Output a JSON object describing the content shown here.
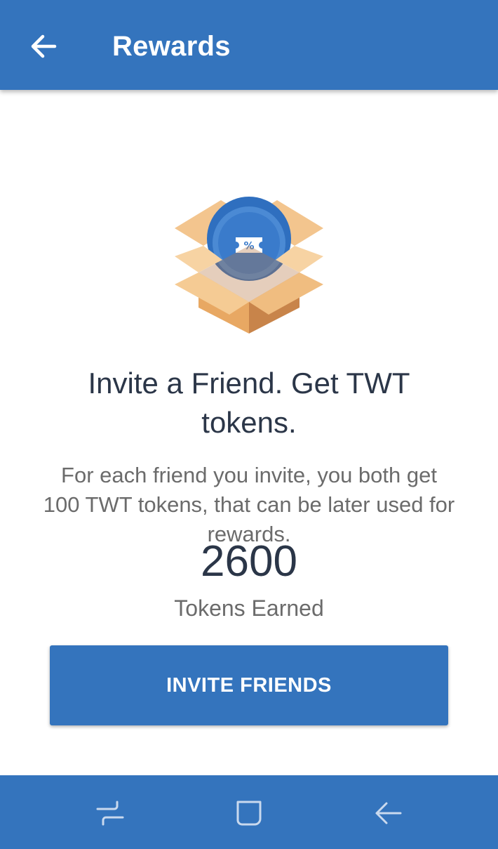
{
  "header": {
    "title": "Rewards",
    "back_icon": "arrow-left-icon"
  },
  "colors": {
    "primary": "#3474bd",
    "text_dark": "#2b3648",
    "text_muted": "#6b6b6b"
  },
  "promo": {
    "illustration_icon": "gift-box-coupon-icon",
    "headline": "Invite a Friend. Get TWT tokens.",
    "description": "For each friend you invite, you both get 100 TWT tokens, that can be later used for rewards."
  },
  "tokens": {
    "count": "2600",
    "label": "Tokens Earned"
  },
  "actions": {
    "invite_label": "INVITE FRIENDS"
  },
  "system_nav": {
    "recents_icon": "recents-icon",
    "home_icon": "home-icon",
    "back_icon": "back-icon"
  }
}
